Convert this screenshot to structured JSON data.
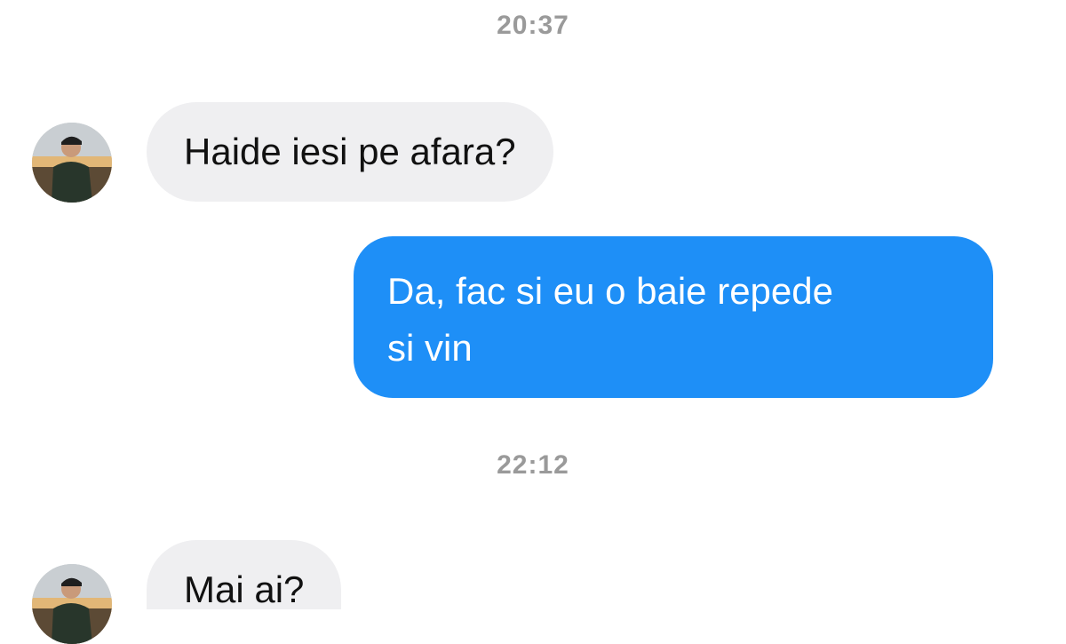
{
  "conversation": {
    "timestamps": [
      "20:37",
      "22:12"
    ],
    "messages": [
      {
        "direction": "incoming",
        "text": "Haide iesi pe afara?"
      },
      {
        "direction": "outgoing",
        "lines": [
          "Da, fac si eu o baie repede",
          "si vin"
        ]
      },
      {
        "direction": "incoming",
        "text": "Mai ai?"
      }
    ]
  },
  "colors": {
    "outgoing_bubble": "#1e8ff7",
    "incoming_bubble": "#efeff1",
    "timestamp_text": "#9a9a9a"
  },
  "icons": {
    "avatar": "contact-avatar"
  }
}
